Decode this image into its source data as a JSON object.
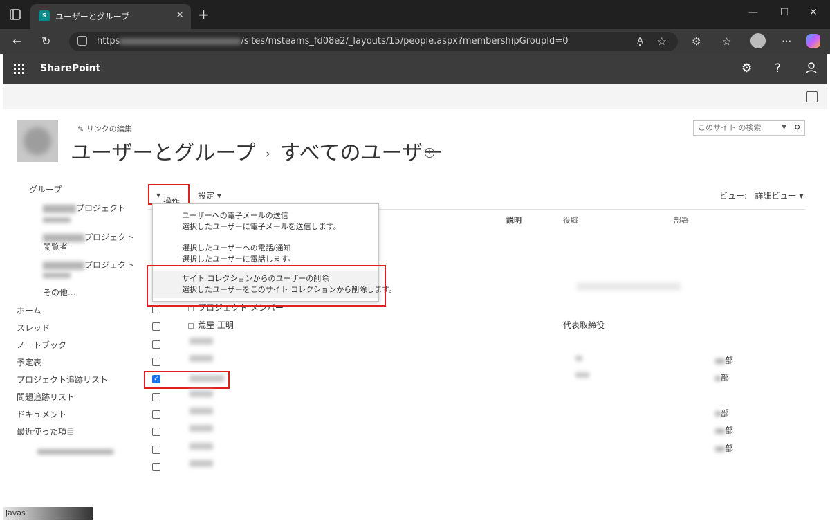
{
  "browser": {
    "tab_title": "ユーザーとグループ",
    "fav_text": "S",
    "url_prefix": "https",
    "url_rest": "/sites/msteams_fd08e2/_layouts/15/people.aspx?membershipGroupId=0",
    "reader_label": "A͈"
  },
  "suite": {
    "brand": "SharePoint"
  },
  "header": {
    "edit_links": "リンクの編集",
    "title_main": "ユーザーとグループ",
    "title_sep": "›",
    "title_sub": "すべてのユーザー",
    "search_placeholder": "このサイト の検索"
  },
  "leftnav": {
    "group_label": "グループ",
    "group1_suffix": "プロジェクト",
    "group2_suffix": "プロジェクト",
    "visitors": "閲覧者",
    "group3_suffix": "プロジェクト",
    "other": "その他...",
    "items": [
      "ホーム",
      "スレッド",
      "ノートブック",
      "予定表",
      "プロジェクト追跡リスト",
      "問題追跡リスト",
      "ドキュメント",
      "最近使った項目"
    ]
  },
  "toolbar": {
    "actions_label": "操作",
    "settings_label": "設定",
    "view_prefix": "ビュー:",
    "view_value": "詳細ビュー"
  },
  "columns": {
    "description": "説明",
    "title": "役職",
    "department": "部署"
  },
  "menu": {
    "items": [
      {
        "title": "ユーザーへの電子メールの送信",
        "desc": "選択したユーザーに電子メールを送信します。"
      },
      {
        "title": "選択したユーザーへの電話/通知",
        "desc": "選択したユーザーに電話します。"
      },
      {
        "title": "サイト コレクションからのユーザーの削除",
        "desc": "選択したユーザーをこのサイト コレクションから削除します。"
      }
    ]
  },
  "rows": {
    "row1_name": "プロジェクト メンバー",
    "row2_name": "荒屋 正明",
    "row2_title": "代表取締役",
    "dept_suffix": "部"
  },
  "status": {
    "text": "javas"
  },
  "colors": {
    "accent_red": "#e02020",
    "suite_bg": "#3c3c3c",
    "check_blue": "#1a73e8"
  }
}
